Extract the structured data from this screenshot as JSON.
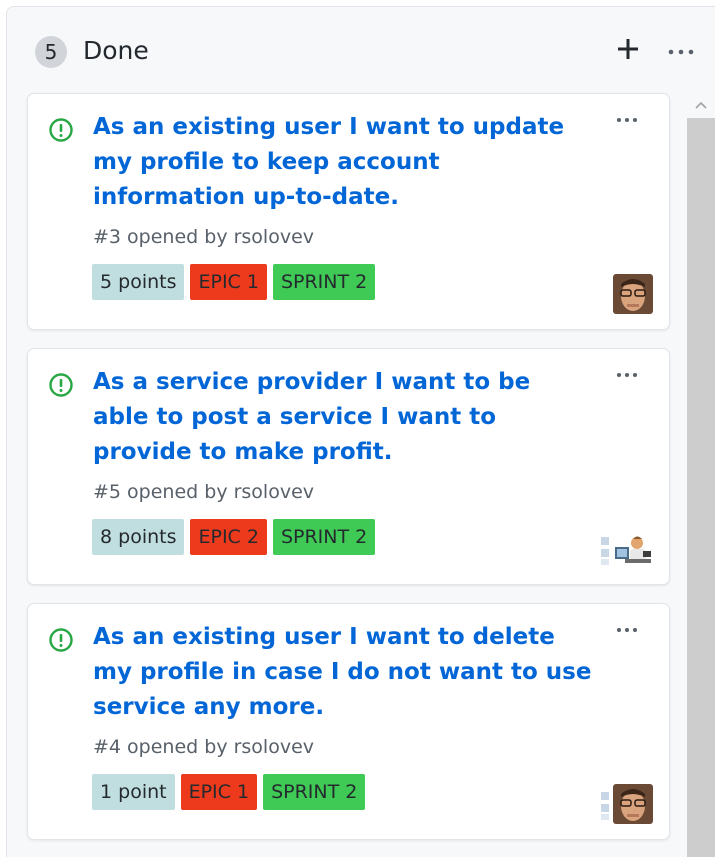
{
  "column": {
    "count": "5",
    "title": "Done",
    "add_icon": "plus-icon",
    "menu_icon": "ellipsis-icon"
  },
  "cards": [
    {
      "title": "As an existing user I want to update my profile to keep account information up-to-date.",
      "meta": "#3 opened by rsolovev",
      "labels": [
        "5 points",
        "EPIC 1",
        "SPRINT 2"
      ]
    },
    {
      "title": "As a service provider I want to be able to post a service I want to provide to make profit.",
      "meta": "#5 opened by rsolovev",
      "labels": [
        "8 points",
        "EPIC 2",
        "SPRINT 2"
      ]
    },
    {
      "title": "As an existing user I want to delete my profile in case I do not want to use service any more.",
      "meta": "#4 opened by rsolovev",
      "labels": [
        "1 point",
        "EPIC 1",
        "SPRINT 2"
      ]
    }
  ],
  "colors": {
    "link": "#0366d6",
    "issue_open": "#28a745",
    "label_points": "#c0dedf",
    "label_epic": "#ee3a1c",
    "label_sprint": "#3fc955"
  }
}
